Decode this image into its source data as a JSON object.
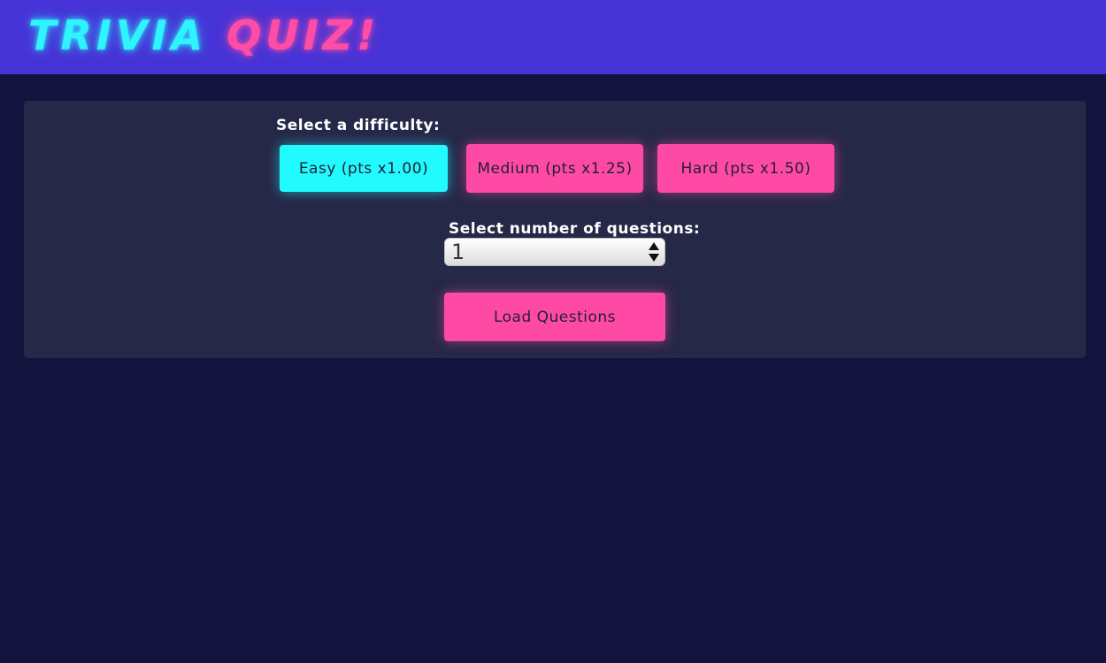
{
  "header": {
    "title_word1": "TRIVIA",
    "title_word2": "QUIZ!"
  },
  "difficulty": {
    "label": "Select a difficulty:",
    "options": [
      {
        "label": "Easy (pts x1.00)",
        "selected": true
      },
      {
        "label": "Medium (pts x1.25)",
        "selected": false
      },
      {
        "label": "Hard (pts x1.50)",
        "selected": false
      }
    ]
  },
  "questions": {
    "label": "Select number of questions:",
    "selected_value": "1"
  },
  "load_button": {
    "label": "Load Questions"
  },
  "colors": {
    "background": "#12143e",
    "header": "#4633d6",
    "panel": "#262848",
    "accent_cyan": "#21fbff",
    "accent_pink": "#ff4aa5"
  },
  "icons": {
    "select_arrows": "updown-arrows-icon"
  }
}
